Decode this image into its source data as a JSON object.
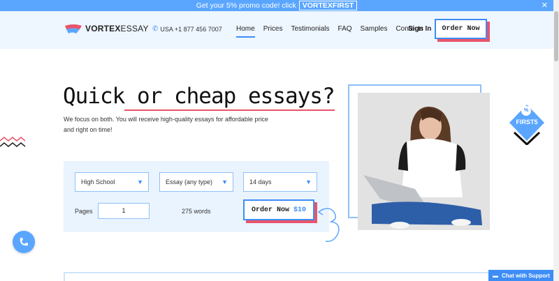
{
  "promo": {
    "text": "Get your 5% promo code! click",
    "code": "VORTEXFIRST",
    "close": "✕"
  },
  "header": {
    "logo_bold": "VORTEX",
    "logo_rest": "ESSAY",
    "phone": "USA +1 877 456 7007",
    "nav": [
      "Home",
      "Prices",
      "Testimonials",
      "FAQ",
      "Samples",
      "Contacts"
    ],
    "signin": "Sign In",
    "order_now": "Order Now"
  },
  "hero": {
    "title_a": "Quick",
    "title_b": " or cheap essays?",
    "subtitle": "We focus on both. You will receive high-quality essays for affordable price and right on time!"
  },
  "form": {
    "level": "High School",
    "type": "Essay (any type)",
    "deadline": "14 days",
    "pages_label": "Pages",
    "pages_value": "1",
    "words": "275 words",
    "order_label": "Order Now",
    "order_price": "$10"
  },
  "badge": {
    "percent": "%",
    "code": "FIRST5"
  },
  "chat": {
    "label": "Chat with Support"
  },
  "colors": {
    "accent": "#3d8df5",
    "promo_bg": "#5aa6ff",
    "header_bg": "#eef6ff",
    "pink": "#e8546a"
  },
  "icons": {
    "phone": "phone-icon",
    "call": "call-icon",
    "chat": "chat-icon",
    "chevron": "chevron-down-icon"
  }
}
